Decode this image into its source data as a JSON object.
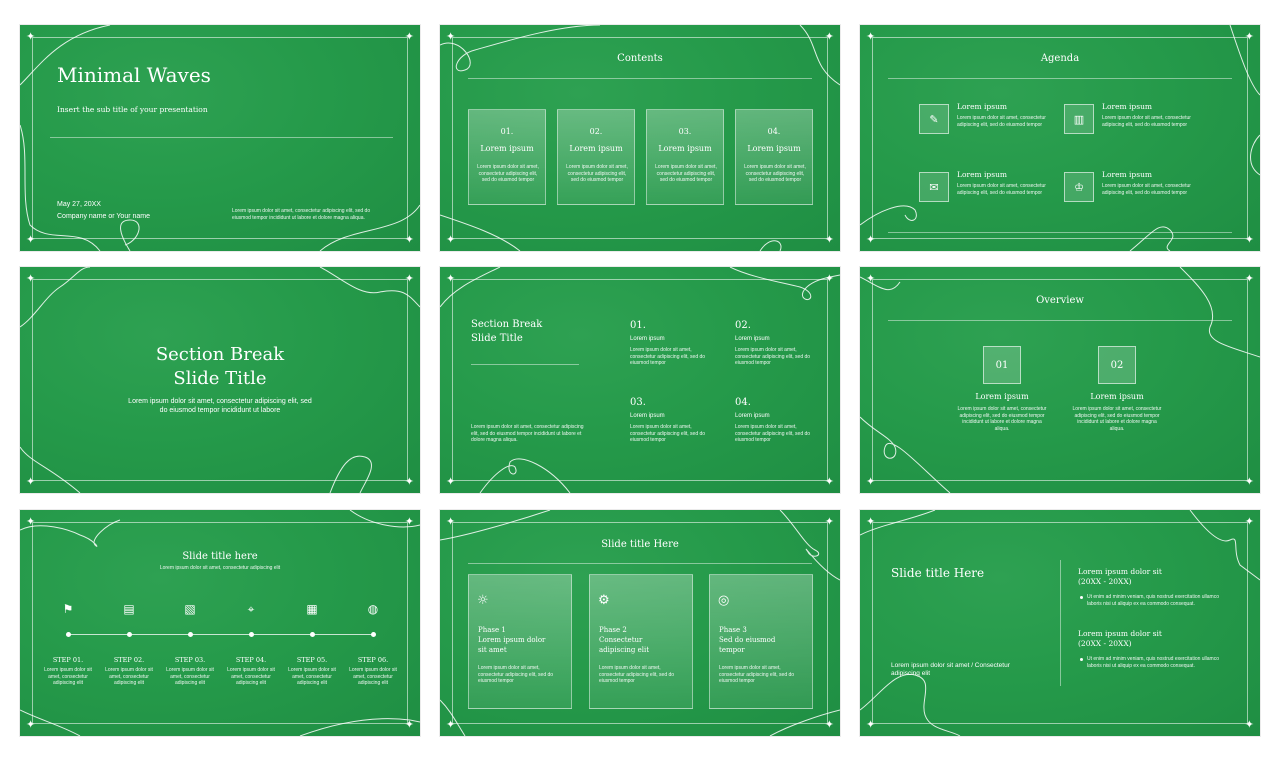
{
  "slide1": {
    "title": "Minimal Waves",
    "subtitle": "Insert the sub title of your presentation",
    "date": "May 27, 20XX",
    "company": "Company name or Your name",
    "blurb": "Lorem ipsum dolor sit amet, consectetur adipiscing elit, sed do eiusmod tempor incididunt ut labore et dolore magna aliqua."
  },
  "slide2": {
    "heading": "Contents",
    "cards": [
      {
        "num": "01.",
        "title": "Lorem ipsum",
        "text": "Lorem ipsum dolor sit amet, consectetur adipiscing elit, sed do eiusmod tempor"
      },
      {
        "num": "02.",
        "title": "Lorem ipsum",
        "text": "Lorem ipsum dolor sit amet, consectetur adipiscing elit, sed do eiusmod tempor"
      },
      {
        "num": "03.",
        "title": "Lorem ipsum",
        "text": "Lorem ipsum dolor sit amet, consectetur adipiscing elit, sed do eiusmod tempor"
      },
      {
        "num": "04.",
        "title": "Lorem ipsum",
        "text": "Lorem ipsum dolor sit amet, consectetur adipiscing elit, sed do eiusmod tempor"
      }
    ]
  },
  "slide3": {
    "heading": "Agenda",
    "items": [
      {
        "icon": "document-edit-icon",
        "glyph": "✎",
        "title": "Lorem ipsum",
        "text": "Lorem ipsum dolor sit amet, consectetur adipiscing elit, sed do eiusmod tempor"
      },
      {
        "icon": "bar-chart-icon",
        "glyph": "▥",
        "title": "Lorem ipsum",
        "text": "Lorem ipsum dolor sit amet, consectetur adipiscing elit, sed do eiusmod tempor"
      },
      {
        "icon": "chat-bubbles-icon",
        "glyph": "✉",
        "title": "Lorem ipsum",
        "text": "Lorem ipsum dolor sit amet, consectetur adipiscing elit, sed do eiusmod tempor"
      },
      {
        "icon": "trophy-icon",
        "glyph": "♔",
        "title": "Lorem ipsum",
        "text": "Lorem ipsum dolor sit amet, consectetur adipiscing elit, sed do eiusmod tempor"
      }
    ]
  },
  "slide4": {
    "title_line1": "Section Break",
    "title_line2": "Slide Title",
    "text": "Lorem ipsum dolor sit amet, consectetur adipiscing elit, sed do eiusmod tempor incididunt ut labore"
  },
  "slide5": {
    "title_line1": "Section Break",
    "title_line2": "Slide Title",
    "text": "Lorem ipsum dolor sit amet, consectetur adipiscing elit, sed do eiusmod tempor incididunt ut labore et dolore magna aliqua.",
    "items": [
      {
        "num": "01.",
        "title": "Lorem ipsum",
        "text": "Lorem ipsum dolor sit amet, consectetur adipiscing elit, sed do eiusmod tempor"
      },
      {
        "num": "02.",
        "title": "Lorem ipsum",
        "text": "Lorem ipsum dolor sit amet, consectetur adipiscing elit, sed do eiusmod tempor"
      },
      {
        "num": "03.",
        "title": "Lorem ipsum",
        "text": "Lorem ipsum dolor sit amet, consectetur adipiscing elit, sed do eiusmod tempor"
      },
      {
        "num": "04.",
        "title": "Lorem ipsum",
        "text": "Lorem ipsum dolor sit amet, consectetur adipiscing elit, sed do eiusmod tempor"
      }
    ]
  },
  "slide6": {
    "heading": "Overview",
    "items": [
      {
        "num": "01",
        "title": "Lorem ipsum",
        "text": "Lorem ipsum dolor sit amet, consectetur adipiscing elit, sed do eiusmod tempor incididunt ut labore et dolore magna aliqua."
      },
      {
        "num": "02",
        "title": "Lorem ipsum",
        "text": "Lorem ipsum dolor sit amet, consectetur adipiscing elit, sed do eiusmod tempor incididunt ut labore et dolore magna aliqua."
      }
    ]
  },
  "slide7": {
    "heading": "Slide title here",
    "subheading": "Lorem ipsum dolor sit amet, consectetur adipiscing elit",
    "steps": [
      {
        "icon": "map-pin-icon",
        "glyph": "⚑",
        "title": "STEP 01.",
        "text": "Lorem ipsum dolor sit amet, consectetur adipiscing elit"
      },
      {
        "icon": "server-icon",
        "glyph": "▤",
        "title": "STEP 02.",
        "text": "Lorem ipsum dolor sit amet, consectetur adipiscing elit"
      },
      {
        "icon": "image-icon",
        "glyph": "▧",
        "title": "STEP 03.",
        "text": "Lorem ipsum dolor sit amet, consectetur adipiscing elit"
      },
      {
        "icon": "location-icon",
        "glyph": "⌖",
        "title": "STEP 04.",
        "text": "Lorem ipsum dolor sit amet, consectetur adipiscing elit"
      },
      {
        "icon": "news-icon",
        "glyph": "▦",
        "title": "STEP 05.",
        "text": "Lorem ipsum dolor sit amet, consectetur adipiscing elit"
      },
      {
        "icon": "globe-icon",
        "glyph": "◍",
        "title": "STEP 06.",
        "text": "Lorem ipsum dolor sit amet, consectetur adipiscing elit"
      }
    ]
  },
  "slide8": {
    "heading": "Slide title Here",
    "phases": [
      {
        "icon": "lightbulb-icon",
        "glyph": "☼",
        "phase": "Phase 1",
        "title1": "Lorem ipsum dolor",
        "title2": "sit amet",
        "text": "Lorem ipsum dolor sit amet, consectetur adipiscing elit, sed do eiusmod tempor"
      },
      {
        "icon": "gear-icon",
        "glyph": "⚙",
        "phase": "Phase 2",
        "title1": "Consectetur",
        "title2": "adipiscing elit",
        "text": "Lorem ipsum dolor sit amet, consectetur adipiscing elit, sed do eiusmod tempor"
      },
      {
        "icon": "target-icon",
        "glyph": "◎",
        "phase": "Phase 3",
        "title1": "Sed do eiusmod",
        "title2": "tempor",
        "text": "Lorem ipsum dolor sit amet, consectetur adipiscing elit, sed do eiusmod tempor"
      }
    ]
  },
  "slide9": {
    "heading": "Slide title Here",
    "footer": "Lorem ipsum dolor sit amet / Consectetur adipiscing elit",
    "blocks": [
      {
        "title": "Lorem ipsum dolor sit",
        "range": "(20XX - 20XX)",
        "text": "Ut enim ad minim veniam, quis nostrud exercitation ullamco laboris nisi ut aliquip ex ea commodo consequat."
      },
      {
        "title": "Lorem ipsum dolor sit",
        "range": "(20XX - 20XX)",
        "text": "Ut enim ad minim veniam, quis nostrud exercitation ullamco laboris nisi ut aliquip ex ea commodo consequat."
      }
    ]
  }
}
